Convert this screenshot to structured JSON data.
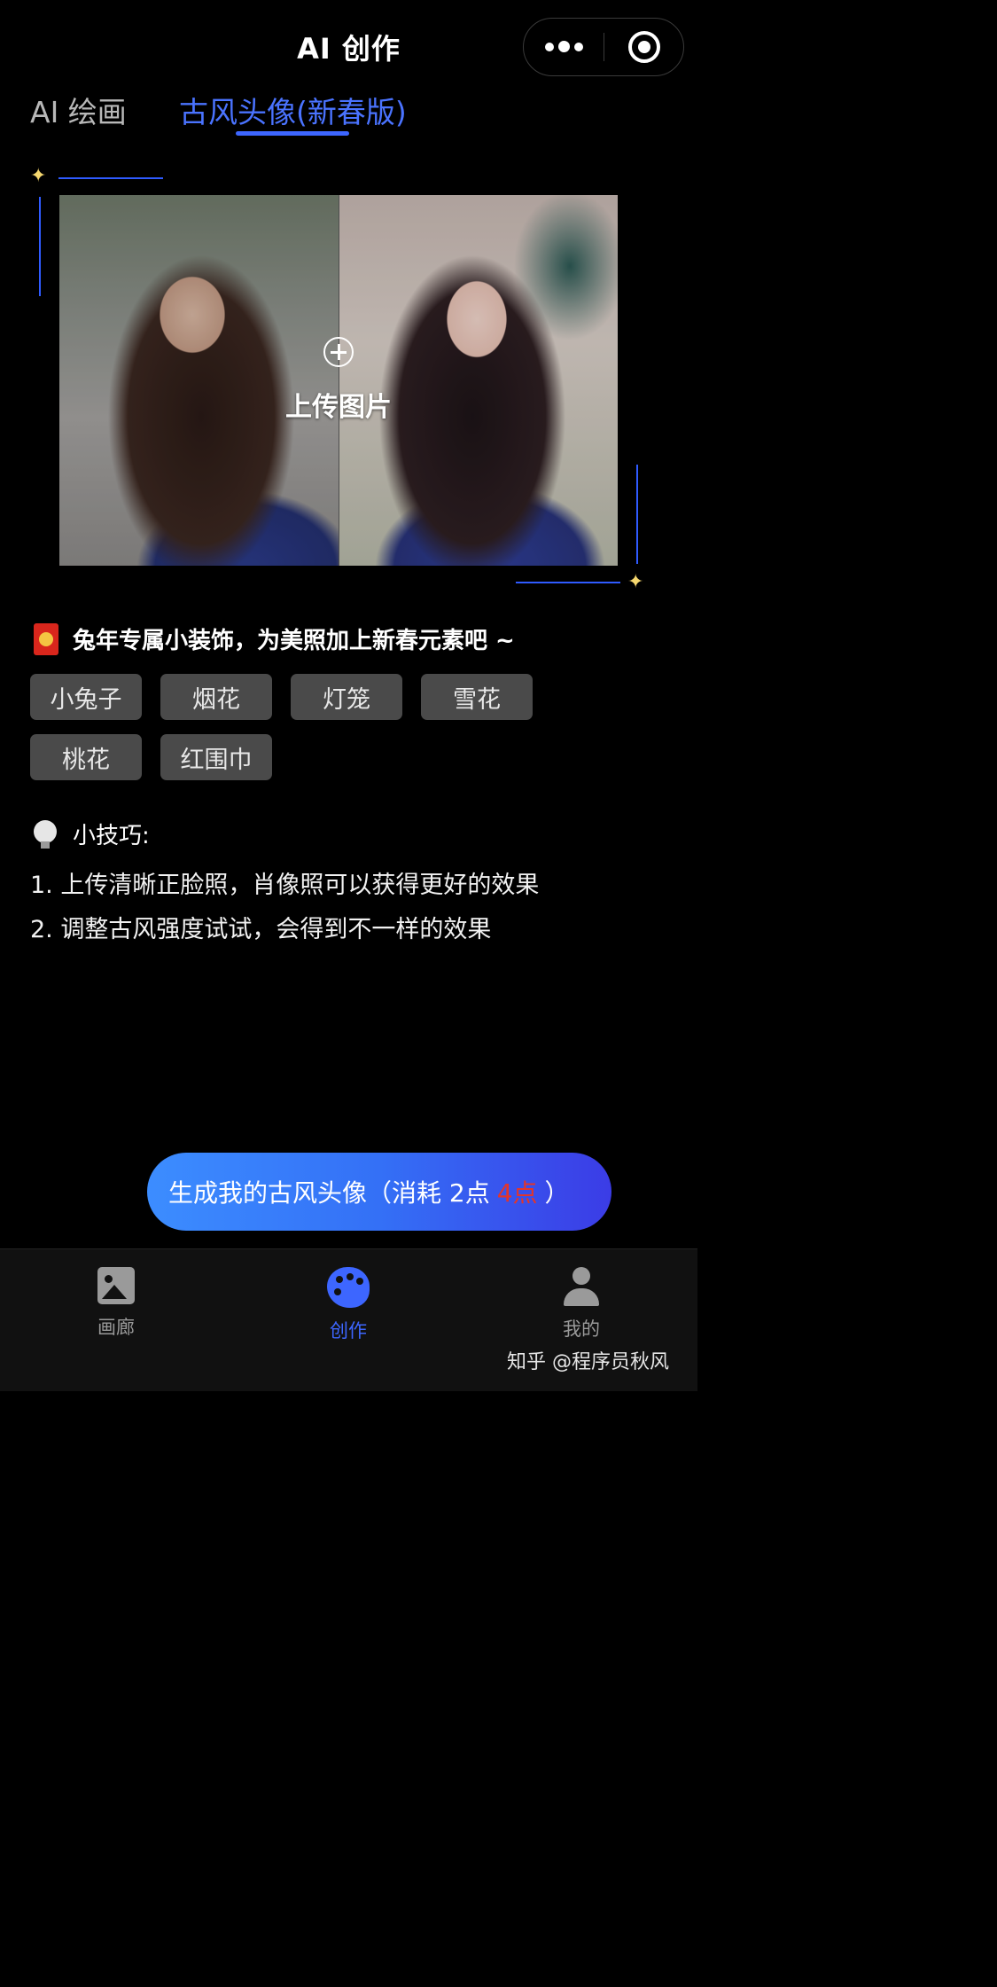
{
  "header": {
    "title": "AI 创作"
  },
  "capsule": {
    "more_icon": "more-dots-icon",
    "close_icon": "target-icon"
  },
  "tabs": [
    {
      "label": "AI 绘画",
      "active": false
    },
    {
      "label": "古风头像(新春版)",
      "active": true
    }
  ],
  "accent_color": "#3d66ff",
  "upload": {
    "label": "上传图片",
    "icon": "plus-circle-icon"
  },
  "decorations": {
    "heading": "兔年专属小装饰，为美照加上新春元素吧 ~",
    "icon": "red-envelope-icon",
    "options": [
      "小兔子",
      "烟花",
      "灯笼",
      "雪花",
      "桃花",
      "红围巾"
    ]
  },
  "tips": {
    "heading": "小技巧:",
    "icon": "lightbulb-icon",
    "items": [
      "1. 上传清晰正脸照，肖像照可以获得更好的效果",
      "2. 调整古风强度试试，会得到不一样的效果"
    ]
  },
  "generate_button": {
    "prefix": "生成我的古风头像（消耗 2点",
    "old_price": "4点",
    "suffix": "）"
  },
  "bottom_nav": [
    {
      "label": "画廊",
      "icon": "gallery-icon",
      "active": false
    },
    {
      "label": "创作",
      "icon": "palette-icon",
      "active": true
    },
    {
      "label": "我的",
      "icon": "user-icon",
      "active": false
    }
  ],
  "watermark": "知乎 @程序员秋风"
}
